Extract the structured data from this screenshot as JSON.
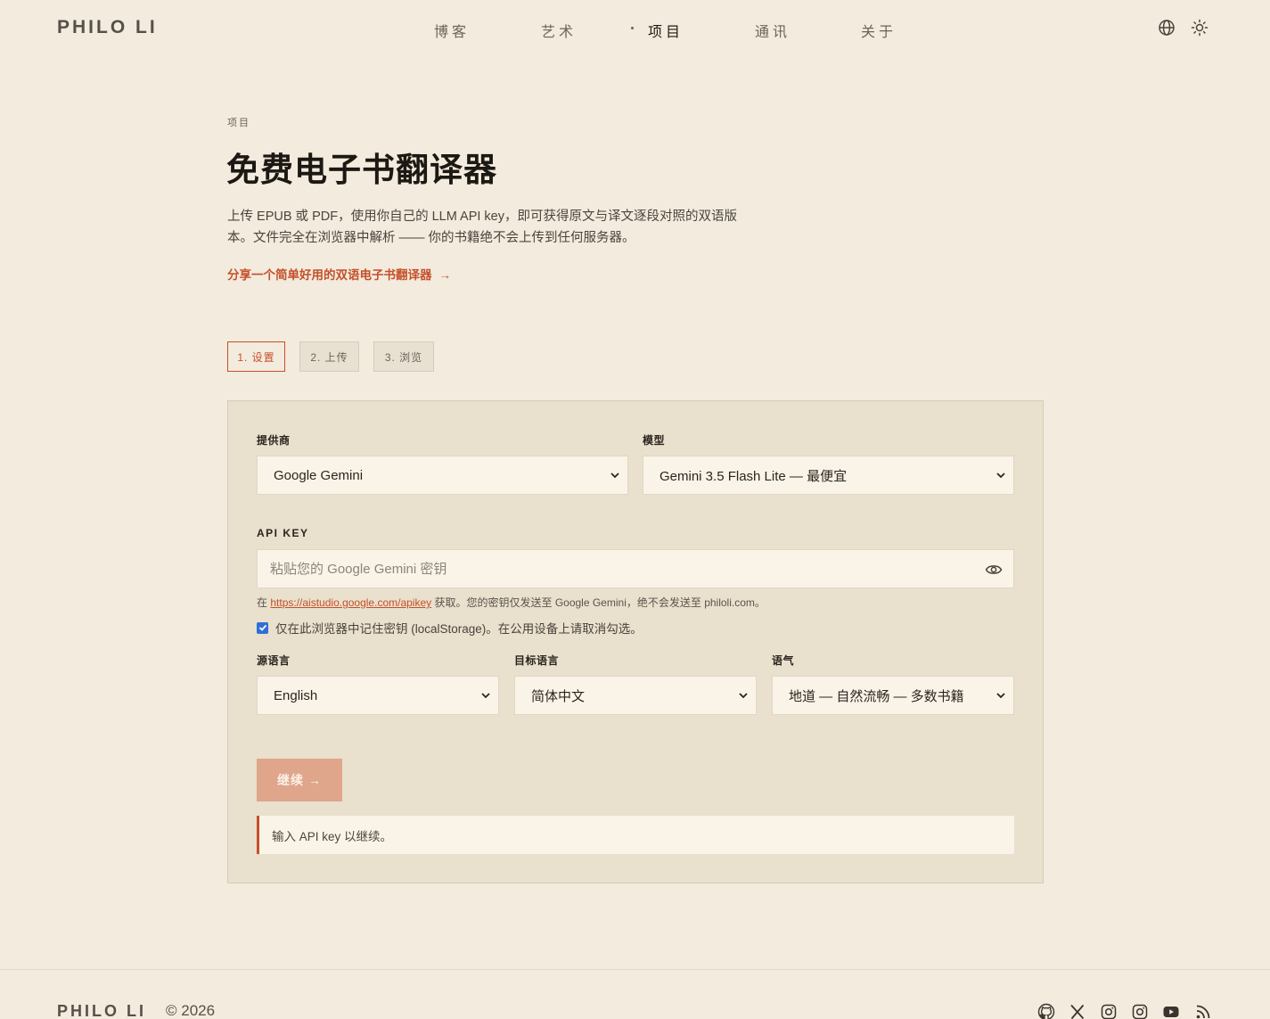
{
  "header": {
    "brand": "PHILO LI",
    "nav": [
      "博客",
      "艺术",
      "项目",
      "通讯",
      "关于"
    ],
    "active_nav": "项目",
    "icons": [
      "globe-icon",
      "sun-icon"
    ]
  },
  "main": {
    "eyebrow": "项目",
    "title": "免费电子书翻译器",
    "lead": "上传 EPUB 或 PDF，使用你自己的 LLM API key，即可获得原文与译文逐段对照的双语版本。文件完全在浏览器中解析 —— 你的书籍绝不会上传到任何服务器。",
    "share_link": "分享一个简单好用的双语电子书翻译器",
    "share_arrow": "→",
    "steps": [
      "1. 设置",
      "2. 上传",
      "3. 浏览"
    ],
    "active_step": "1. 设置"
  },
  "form": {
    "provider_label": "提供商",
    "provider_value": "Google Gemini",
    "model_label": "模型",
    "model_value": "Gemini 3.5 Flash Lite — 最便宜",
    "api_key_label": "API KEY",
    "api_key_placeholder": "粘贴您的 Google Gemini 密钥",
    "hint_prefix": "在",
    "hint_link": "https://aistudio.google.com/apikey",
    "hint_suffix": "获取。您的密钥仅发送至 Google Gemini，绝不会发送至 philoli.com。",
    "remember_label": "仅在此浏览器中记住密钥 (localStorage)。在公用设备上请取消勾选。",
    "remember_checked": true,
    "source_label": "源语言",
    "source_value": "English",
    "target_label": "目标语言",
    "target_value": "简体中文",
    "tone_label": "语气",
    "tone_value": "地道 — 自然流畅 — 多数书籍",
    "continue_label": "继续",
    "continue_arrow": "→",
    "notice": "输入 API key 以继续。"
  },
  "footer": {
    "brand": "PHILO LI",
    "copyright": "© 2026",
    "social_icons": [
      "github-icon",
      "x-icon",
      "instagram-icon",
      "instagram-icon",
      "youtube-icon",
      "rss-icon"
    ]
  },
  "colors": {
    "background": "#f3ebdd",
    "card": "#e9e0cd",
    "accent": "#c4502a",
    "button": "#dfa68c"
  }
}
